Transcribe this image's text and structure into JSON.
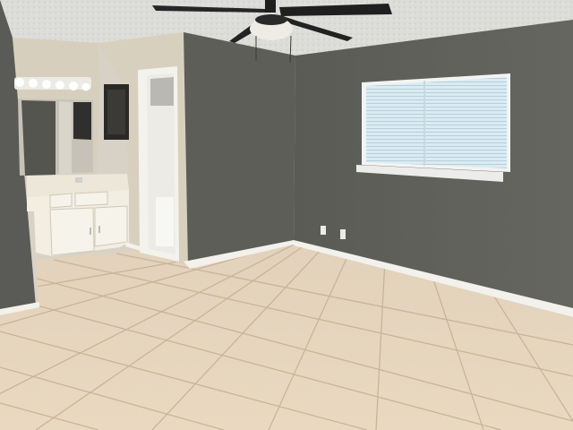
{
  "scene": {
    "colors": {
      "ceiling": "#d9d9d4",
      "wall_gray": "#5f605a",
      "wall_left": "#595a55",
      "wall_beige": "#d8d0be",
      "baseboard": "#f2f1ec",
      "floor_tile": "#e6d5bd",
      "grout": "#cbb69b",
      "window_blind": "#d9ebf3",
      "vanity_cabinet": "#f3efe2",
      "fan": "#222222"
    },
    "objects": [
      "ceiling-fan",
      "vanity-light-bar",
      "bathroom-mirror",
      "medicine-cabinet",
      "bathroom-vanity-cabinet",
      "bathroom-doorway",
      "window-with-blinds",
      "electrical-outlet",
      "tile-floor",
      "baseboard"
    ]
  }
}
